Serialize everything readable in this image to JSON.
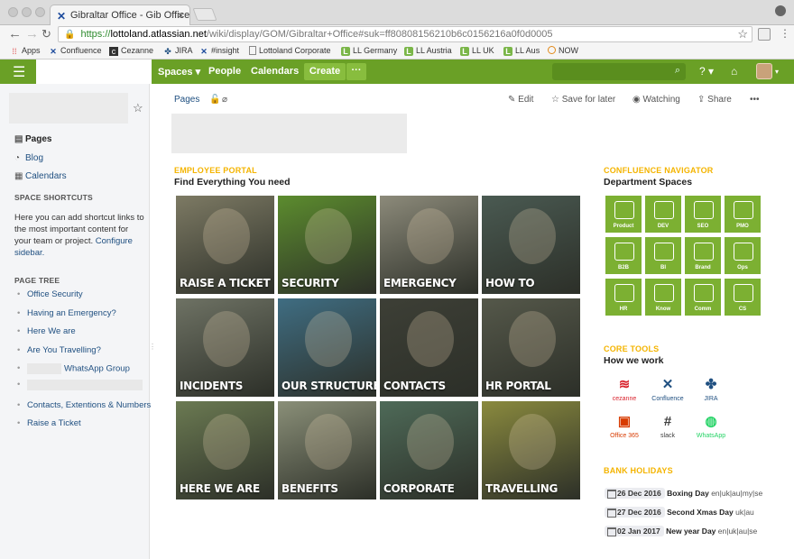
{
  "browser": {
    "tab_title": "Gibraltar Office - Gib Office M",
    "url_prefix": "https://",
    "url_host": "lottoland.atlassian.net",
    "url_path": "/wiki/display/GOM/Gibraltar+Office#suk=ff80808156210b6c0156216a0f0d0005",
    "bookmarks": [
      {
        "label": "Apps",
        "icon": "apps-grid-icon"
      },
      {
        "label": "Confluence",
        "icon": "confluence-icon"
      },
      {
        "label": "Cezanne",
        "icon": "cezanne-icon"
      },
      {
        "label": "JIRA",
        "icon": "jira-icon"
      },
      {
        "label": "#insight",
        "icon": "confluence-icon"
      },
      {
        "label": "Lottoland Corporate",
        "icon": "page-icon"
      },
      {
        "label": "LL Germany",
        "icon": "ll-icon"
      },
      {
        "label": "LL Austria",
        "icon": "ll-icon"
      },
      {
        "label": "LL UK",
        "icon": "ll-icon"
      },
      {
        "label": "LL Aus",
        "icon": "ll-icon"
      },
      {
        "label": "NOW",
        "icon": "now-icon"
      }
    ]
  },
  "header": {
    "spaces": "Spaces ▾",
    "people": "People",
    "calendars": "Calendars",
    "create": "Create",
    "more": "···",
    "help": "? ▾",
    "colors": {
      "bar": "#6aa026",
      "button": "#88bd3e"
    }
  },
  "sidebar": {
    "nav": [
      {
        "label": "Pages",
        "icon": "pages-icon"
      },
      {
        "label": "Blog",
        "icon": "rss-icon"
      },
      {
        "label": "Calendars",
        "icon": "calendar-icon"
      }
    ],
    "shortcuts_heading": "SPACE SHORTCUTS",
    "shortcuts_text": "Here you can add shortcut links to the most important content for your team or project.",
    "configure_link": "Configure sidebar.",
    "tree_heading": "PAGE TREE",
    "tree": [
      "Office Security",
      "Having an Emergency?",
      "Here We are",
      "Are You Travelling?",
      "WhatsApp Group",
      "",
      "Contacts, Extentions & Numbers",
      "Raise a Ticket"
    ]
  },
  "page": {
    "breadcrumb": "Pages",
    "actions": {
      "edit": "Edit",
      "save": "Save for later",
      "watch": "Watching",
      "share": "Share",
      "more": "•••"
    },
    "portal_label": "EMPLOYEE PORTAL",
    "portal_title": "Find Everything You need",
    "tiles": [
      {
        "label": "RAISE A TICKET",
        "bg": "#7d7a64"
      },
      {
        "label": "SECURITY",
        "bg": "#5c8c2e"
      },
      {
        "label": "EMERGENCY",
        "bg": "#8c8a7a"
      },
      {
        "label": "HOW TO",
        "bg": "#4a5a52"
      },
      {
        "label": "INCIDENTS",
        "bg": "#6e7264"
      },
      {
        "label": "OUR STRUCTURE",
        "bg": "#3f6d82"
      },
      {
        "label": "CONTACTS",
        "bg": "#3d3f36"
      },
      {
        "label": "HR PORTAL",
        "bg": "#55584a"
      },
      {
        "label": "HERE WE ARE",
        "bg": "#6b7a52"
      },
      {
        "label": "BENEFITS",
        "bg": "#8a8f78"
      },
      {
        "label": "CORPORATE",
        "bg": "#4e6a58"
      },
      {
        "label": "TRAVELLING",
        "bg": "#8a8a3e"
      }
    ],
    "navigator_label": "CONFLUENCE NAVIGATOR",
    "navigator_title": "Department Spaces",
    "departments": [
      "Product",
      "DEV",
      "SEO",
      "PMO",
      "B2B",
      "BI",
      "Brand",
      "Ops",
      "HR",
      "Know",
      "Comm",
      "CS"
    ],
    "tools_label": "CORE TOOLS",
    "tools_title": "How we work",
    "tools": [
      {
        "label": "cezanne",
        "icon": "cezanne-icon",
        "color": "#d9232d"
      },
      {
        "label": "Confluence",
        "icon": "confluence-icon",
        "color": "#205081"
      },
      {
        "label": "JIRA",
        "icon": "jira-icon",
        "color": "#205081"
      },
      {
        "label": "Office 365",
        "icon": "office365-icon",
        "color": "#d83b01"
      },
      {
        "label": "slack",
        "icon": "slack-icon",
        "color": "#3e3e3e"
      },
      {
        "label": "WhatsApp",
        "icon": "whatsapp-icon",
        "color": "#25d366"
      }
    ],
    "holidays_label": "BANK HOLIDAYS",
    "holidays": [
      {
        "date": "26 Dec 2016",
        "name": "Boxing Day",
        "codes": "en|uk|au|my|se"
      },
      {
        "date": "27 Dec 2016",
        "name": "Second Xmas Day",
        "codes": "uk|au"
      },
      {
        "date": "02 Jan 2017",
        "name": "New year Day",
        "codes": "en|uk|au|se"
      }
    ],
    "accent": "#f4b400"
  }
}
